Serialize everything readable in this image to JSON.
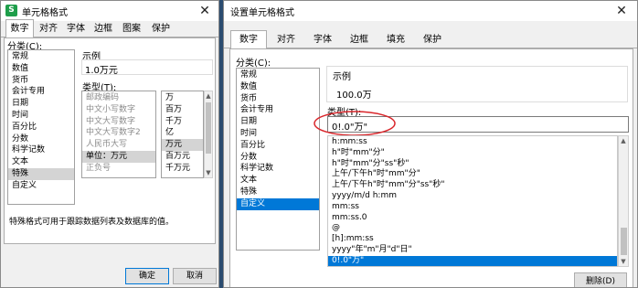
{
  "left_dialog": {
    "title": "单元格格式",
    "close_glyph": "✕",
    "tabs": [
      "数字",
      "对齐",
      "字体",
      "边框",
      "图案",
      "保护"
    ],
    "category_label": "分类(C):",
    "categories": [
      "常规",
      "数值",
      "货币",
      "会计专用",
      "日期",
      "时间",
      "百分比",
      "分数",
      "科学记数",
      "文本",
      "特殊",
      "自定义"
    ],
    "selected_category": "特殊",
    "sample_label": "示例",
    "sample_value": "1.0万元",
    "type_label": "类型(T):",
    "types": [
      "邮政编码",
      "中文小写数字",
      "中文大写数字",
      "中文大写数字2",
      "人民币大写",
      "单位：万元",
      "正负号"
    ],
    "selected_type": "单位：万元",
    "units": [
      "万",
      "百万",
      "千万",
      "亿",
      "万元",
      "百万元",
      "千万元"
    ],
    "selected_unit": "万元",
    "description": "特殊格式可用于跟踪数据列表及数据库的值。",
    "ok_label": "确定",
    "cancel_label": "取消"
  },
  "right_dialog": {
    "title": "设置单元格格式",
    "close_glyph": "✕",
    "tabs": [
      "数字",
      "对齐",
      "字体",
      "边框",
      "填充",
      "保护"
    ],
    "category_label": "分类(C):",
    "categories": [
      "常规",
      "数值",
      "货币",
      "会计专用",
      "日期",
      "时间",
      "百分比",
      "分数",
      "科学记数",
      "文本",
      "特殊",
      "自定义"
    ],
    "selected_category": "自定义",
    "sample_label": "示例",
    "sample_value": "100.0万",
    "type_label": "类型(T):",
    "type_value": "0!.0\"万\"",
    "formats": [
      "h:mm:ss",
      "h\"时\"mm\"分\"",
      "h\"时\"mm\"分\"ss\"秒\"",
      "上午/下午h\"时\"mm\"分\"",
      "上午/下午h\"时\"mm\"分\"ss\"秒\"",
      "yyyy/m/d h:mm",
      "mm:ss",
      "mm:ss.0",
      "@",
      "[h]:mm:ss",
      "yyyy\"年\"m\"月\"d\"日\"",
      "0!.0\"万\""
    ],
    "selected_format": "0!.0\"万\"",
    "delete_label": "删除(D)"
  },
  "colors": {
    "selection": "#0078d7",
    "annotation_circle": "#d9262b",
    "app_icon": "#1e9e4a"
  }
}
